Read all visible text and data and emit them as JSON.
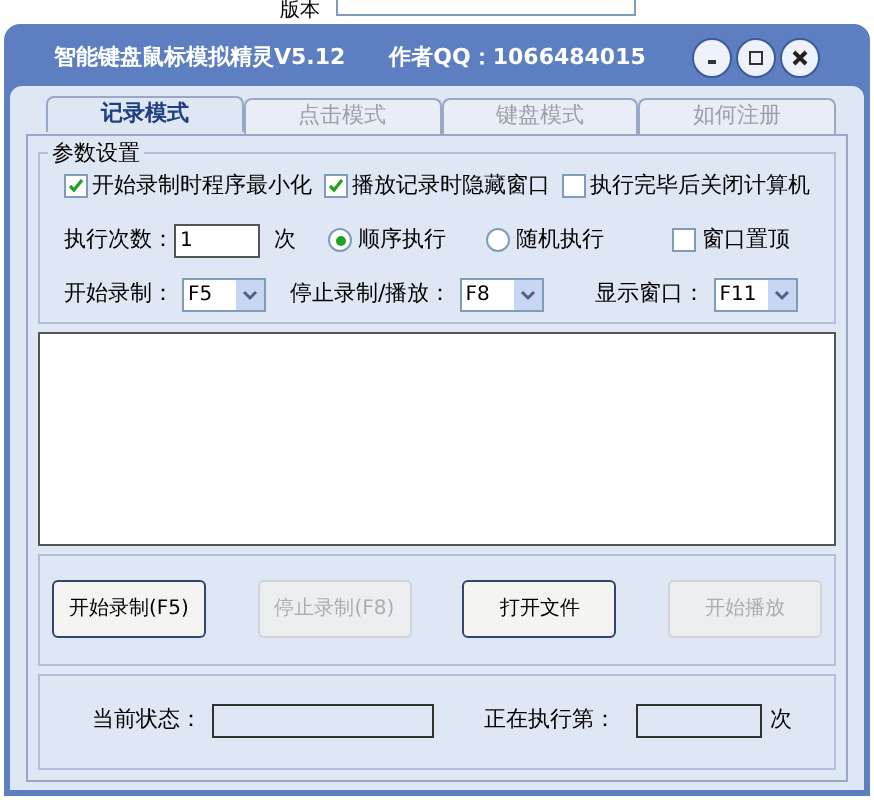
{
  "background": {
    "label": "版本"
  },
  "window": {
    "title": "智能键盘鼠标模拟精灵V5.12",
    "author": "作者QQ：1066484015"
  },
  "tabs": [
    {
      "label": "记录模式",
      "selected": true
    },
    {
      "label": "点击模式",
      "selected": false
    },
    {
      "label": "键盘模式",
      "selected": false
    },
    {
      "label": "如何注册",
      "selected": false
    }
  ],
  "settings": {
    "title": "参数设置",
    "options": [
      {
        "label": "开始录制时程序最小化",
        "checked": true
      },
      {
        "label": "播放记录时隐藏窗口",
        "checked": true
      },
      {
        "label": "执行完毕后关闭计算机",
        "checked": false
      }
    ],
    "repeat_label": "执行次数：",
    "repeat_value": "1",
    "repeat_unit": "次",
    "modes": [
      {
        "label": "顺序执行",
        "selected": true
      },
      {
        "label": "随机执行",
        "selected": false
      }
    ],
    "topmost": {
      "label": "窗口置顶",
      "checked": false
    },
    "hotkeys": [
      {
        "label": "开始录制：",
        "value": "F5"
      },
      {
        "label": "停止录制/播放：",
        "value": "F8"
      },
      {
        "label": "显示窗口：",
        "value": "F11"
      }
    ]
  },
  "buttons": [
    {
      "label": "开始录制(F5)",
      "disabled": false
    },
    {
      "label": "停止录制(F8)",
      "disabled": true
    },
    {
      "label": "打开文件",
      "disabled": false
    },
    {
      "label": "开始播放",
      "disabled": true
    }
  ],
  "status": {
    "state_label": "当前状态：",
    "progress_label": "正在执行第：",
    "progress_unit": "次"
  }
}
